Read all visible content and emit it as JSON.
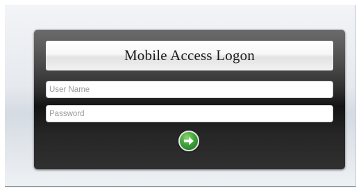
{
  "login": {
    "title": "Mobile Access Logon",
    "username": {
      "placeholder": "User Name",
      "value": ""
    },
    "password": {
      "placeholder": "Password",
      "value": ""
    },
    "submit": {
      "icon": "right-arrow-icon",
      "color": "#3ea33a"
    }
  }
}
